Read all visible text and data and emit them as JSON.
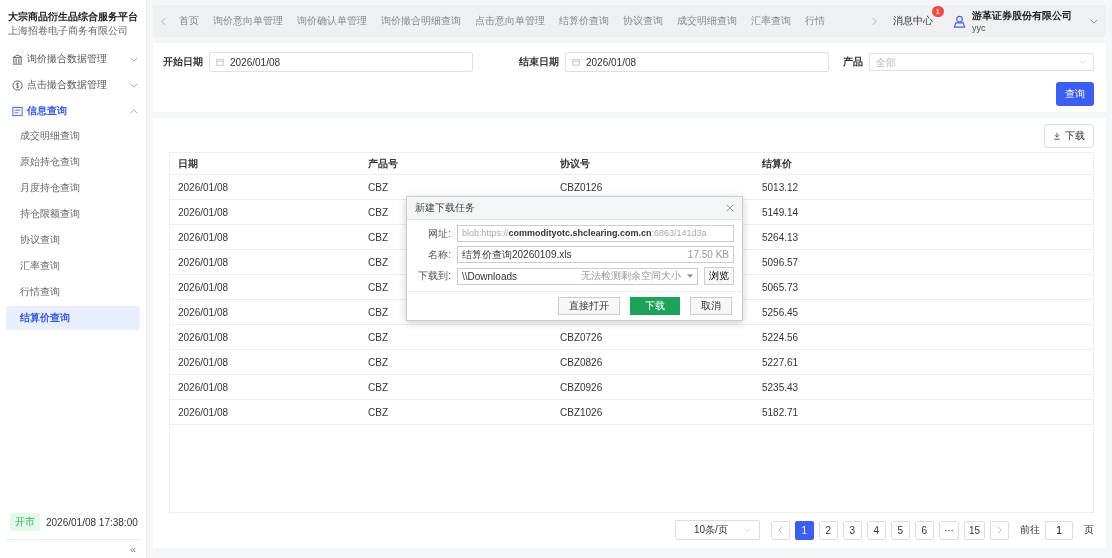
{
  "sidebar": {
    "title": "大宗商品衍生品综合服务平台",
    "subtitle": "上海招卷电子商务有限公司",
    "groups": [
      {
        "label": "询价撮合数据管理",
        "expanded": false,
        "selected": false
      },
      {
        "label": "点击撮合数据管理",
        "expanded": false,
        "selected": false
      },
      {
        "label": "信息查询",
        "expanded": true,
        "selected": true,
        "children": [
          {
            "label": "成交明细查询",
            "selected": false
          },
          {
            "label": "原始持仓查询",
            "selected": false
          },
          {
            "label": "月度持仓查询",
            "selected": false
          },
          {
            "label": "持仓限额查询",
            "selected": false
          },
          {
            "label": "协议查询",
            "selected": false
          },
          {
            "label": "汇率查询",
            "selected": false
          },
          {
            "label": "行情查询",
            "selected": false
          },
          {
            "label": "结算价查询",
            "selected": true
          }
        ]
      }
    ],
    "market_status": "开市",
    "time": "2026/01/08 17:38:00",
    "collapse": "«"
  },
  "top_nav": {
    "tabs": [
      "首页",
      "询价意向单管理",
      "询价确认单管理",
      "询价撮合明细查询",
      "点击意向单管理",
      "结算价查询",
      "协议查询",
      "成交明细查询",
      "汇率查询",
      "行情"
    ],
    "messages": {
      "label": "消息中心",
      "badge": "1"
    },
    "user": {
      "company": "游革证券股份有限公司",
      "name": "yyc"
    }
  },
  "filters": {
    "start_date": {
      "label": "开始日期",
      "value": "2026/01/08"
    },
    "end_date": {
      "label": "结束日期",
      "value": "2026/01/08"
    },
    "product": {
      "label": "产品",
      "placeholder": "全部"
    },
    "query_button": "查询"
  },
  "table": {
    "download_button": "下载",
    "columns": [
      "日期",
      "产品号",
      "协议号",
      "结算价"
    ],
    "rows": [
      {
        "date": "2026/01/08",
        "product": "CBZ",
        "agreement": "CBZ0126",
        "price": "5013.12"
      },
      {
        "date": "2026/01/08",
        "product": "CBZ",
        "price": "5149.14"
      },
      {
        "date": "2026/01/08",
        "product": "CBZ",
        "price": "5264.13"
      },
      {
        "date": "2026/01/08",
        "product": "CBZ",
        "price": "5096.57"
      },
      {
        "date": "2026/01/08",
        "product": "CBZ",
        "price": "5065.73"
      },
      {
        "date": "2026/01/08",
        "product": "CBZ",
        "price": "5256.45"
      },
      {
        "date": "2026/01/08",
        "product": "CBZ",
        "agreement": "CBZ0726",
        "price": "5224.56"
      },
      {
        "date": "2026/01/08",
        "product": "CBZ",
        "agreement": "CBZ0826",
        "price": "5227.61"
      },
      {
        "date": "2026/01/08",
        "product": "CBZ",
        "agreement": "CBZ0926",
        "price": "5235.43"
      },
      {
        "date": "2026/01/08",
        "product": "CBZ",
        "agreement": "CBZ1026",
        "price": "5182.71"
      }
    ]
  },
  "pagination": {
    "page_size": "10条/页",
    "pages": [
      {
        "label": "1",
        "selected": true
      },
      {
        "label": "2",
        "selected": false
      },
      {
        "label": "3",
        "selected": false
      },
      {
        "label": "4",
        "selected": false
      },
      {
        "label": "5",
        "selected": false
      },
      {
        "label": "6",
        "selected": false
      },
      {
        "label": "···",
        "selected": false
      },
      {
        "label": "15",
        "selected": false
      }
    ],
    "goto_label": "前往",
    "goto_value": "1",
    "page_suffix": "页"
  },
  "dialog": {
    "title": "新建下载任务",
    "url_label": "网址:",
    "url": "blob:https://**commodityotc.shclearing.com.cn**:6863/141d3a",
    "name_label": "名称:",
    "file_name": "结算价查询20260109.xls",
    "size": "17.50 KB",
    "dest_label": "下载到:",
    "dest": "\\\\Downloads",
    "space_note": "无法检测剩余空间大小",
    "browse": "浏览",
    "buttons": [
      {
        "label": "直接打开",
        "kind": "default"
      },
      {
        "label": "下载",
        "kind": "primary"
      },
      {
        "label": "取消",
        "kind": "default"
      }
    ]
  }
}
